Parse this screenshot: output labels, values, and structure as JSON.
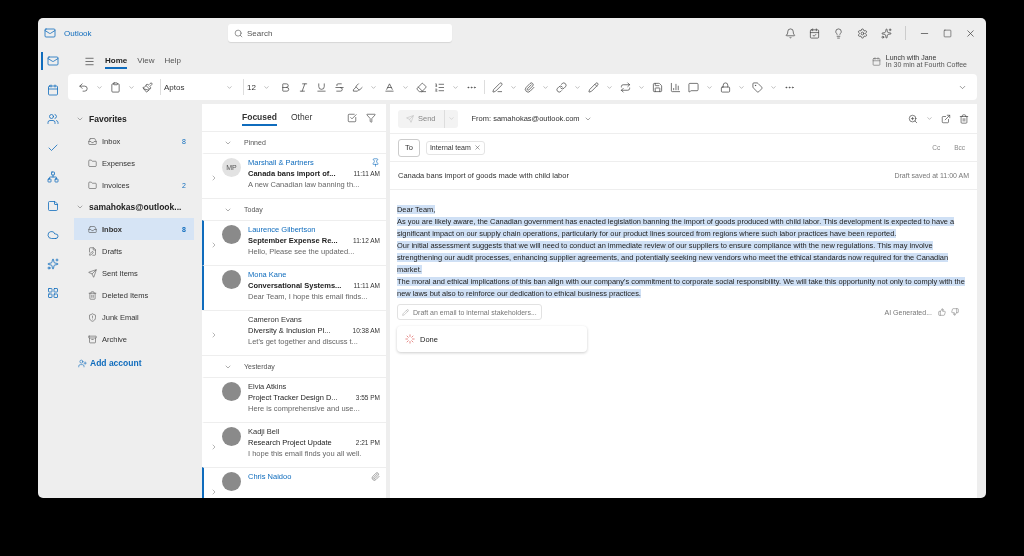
{
  "window": {
    "app_name": "Outlook"
  },
  "search": {
    "placeholder": "Search"
  },
  "reminder": {
    "title": "Lunch with Jane",
    "detail": "In 30 min at Fourth Coffee"
  },
  "rail": [
    {
      "kind": "mail",
      "selected": true
    },
    {
      "kind": "calendar",
      "selected": false
    },
    {
      "kind": "people",
      "selected": false
    },
    {
      "kind": "todo",
      "selected": false
    },
    {
      "kind": "org",
      "selected": false
    },
    {
      "kind": "notes",
      "selected": false
    },
    {
      "kind": "cloud",
      "selected": false
    },
    {
      "kind": "copilot",
      "selected": false
    },
    {
      "kind": "apps",
      "selected": false
    }
  ],
  "ribbon_tabs": [
    {
      "label": "Home",
      "selected": true
    },
    {
      "label": "View",
      "selected": false
    },
    {
      "label": "Help",
      "selected": false
    }
  ],
  "toolbar": {
    "font": "Aptos",
    "size": "12"
  },
  "folders": [
    {
      "label": "Favorites",
      "expanded": true,
      "items": [
        {
          "kind": "inbox",
          "label": "Inbox",
          "count": "8",
          "selected": false
        },
        {
          "kind": "folder",
          "label": "Expenses",
          "selected": false
        },
        {
          "kind": "folder",
          "label": "Invoices",
          "count": "2",
          "selected": false
        }
      ]
    },
    {
      "label": "samahokas@outlook...",
      "expanded": true,
      "items": [
        {
          "kind": "inbox",
          "label": "Inbox",
          "count": "8",
          "selected": true
        },
        {
          "kind": "drafts",
          "label": "Drafts",
          "selected": false
        },
        {
          "kind": "sent",
          "label": "Sent Items",
          "selected": false
        },
        {
          "kind": "deleted",
          "label": "Deleted Items",
          "selected": false
        },
        {
          "kind": "junk",
          "label": "Junk Email",
          "selected": false
        },
        {
          "kind": "archive",
          "label": "Archive",
          "selected": false
        }
      ]
    }
  ],
  "add_account": "Add account",
  "message_tabs": [
    {
      "label": "Focused",
      "selected": true
    },
    {
      "label": "Other",
      "selected": false
    }
  ],
  "message_groups": [
    {
      "label": "Pinned",
      "expanded": true,
      "messages": [
        {
          "sender": "Marshall & Partners",
          "subject": "Canada bans import of...",
          "time": "11:11 AM",
          "preview": "A new Canadian law banning th...",
          "kind": "initials",
          "initials": "MP",
          "thread": true,
          "unread": true,
          "marked": false,
          "pinned": true,
          "attachment": false
        }
      ]
    },
    {
      "label": "Today",
      "expanded": true,
      "messages": [
        {
          "sender": "Laurence Gilbertson",
          "subject": "September Expense Re...",
          "time": "11:12 AM",
          "preview": "Hello, Please see the updated...",
          "kind": "photo",
          "thread": true,
          "unread": true,
          "marked": true,
          "pinned": false,
          "attachment": false
        },
        {
          "sender": "Mona Kane",
          "subject": "Conversational Systems...",
          "time": "11:11 AM",
          "preview": "Dear Team, I hope this email finds...",
          "kind": "photo",
          "thread": false,
          "unread": true,
          "marked": true,
          "pinned": false,
          "attachment": false
        },
        {
          "sender": "Cameron Evans",
          "subject": "Diversity & Inclusion Pl...",
          "time": "10:38 AM",
          "preview": "Let's get together and discuss t...",
          "kind": "no-avatar",
          "thread": true,
          "unread": false,
          "marked": false,
          "pinned": false,
          "attachment": false
        }
      ]
    },
    {
      "label": "Yesterday",
      "expanded": true,
      "messages": [
        {
          "sender": "Elvia Atkins",
          "subject": "Project Tracker Design D...",
          "time": "3:55 PM",
          "preview": "Here is comprehensive and use...",
          "kind": "photo",
          "thread": false,
          "unread": false,
          "marked": false,
          "pinned": false,
          "attachment": false
        },
        {
          "sender": "Kadji Bell",
          "subject": "Research Project Update",
          "time": "2:21 PM",
          "preview": "I hope this email finds you all well.",
          "kind": "photo",
          "thread": true,
          "unread": false,
          "marked": false,
          "pinned": false,
          "attachment": false
        },
        {
          "sender": "Chris Naidoo",
          "kind": "photo",
          "thread": true,
          "unread": true,
          "marked": true,
          "pinned": false,
          "attachment": true
        }
      ]
    }
  ],
  "compose": {
    "send": {
      "label": "Send",
      "disabled": true
    },
    "from": "From: samahokas@outlook.com",
    "to_label": "To",
    "recipients": [
      "Internal team"
    ],
    "cc": "Cc",
    "bcc": "Bcc",
    "subject": "Canada bans import of goods made with child labor",
    "saved": "Draft saved at 11:00 AM",
    "body": {
      "selected": true,
      "paragraphs": [
        "Dear Team,",
        "As you are likely aware, the Canadian government has enacted legislation banning the import of goods produced with child labor. This development is expected to have a significant impact on our supply chain operations, particularly for our product lines sourced from regions where such labor practices have been reported.",
        "Our initial assessment suggests that we will need to conduct an immediate review of our suppliers to ensure compliance with the new regulations. This may involve strengthening our audit processes, enhancing supplier agreements, and potentially seeking new vendors who meet the ethical standards now required for the Canadian market.",
        "The moral and ethical implications of this ban align with our company's commitment to corporate social responsibility. We will take this opportunity not only to comply with the new laws but also to reinforce our dedication to ethical business practices."
      ]
    },
    "prompt": "Draft an email to internal stakeholders...",
    "ai_label": "AI Generated...",
    "done": "Done"
  }
}
